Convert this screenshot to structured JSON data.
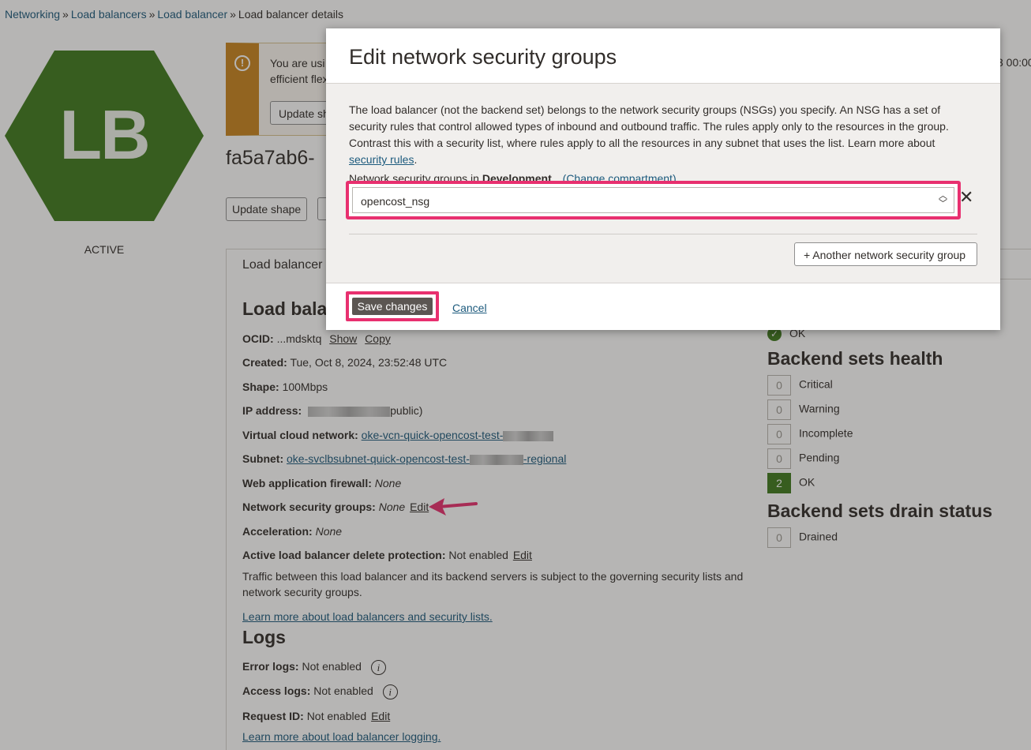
{
  "breadcrumb": {
    "items": [
      "Networking",
      "Load balancers",
      "Load balancer"
    ],
    "current": "Load balancer details",
    "separator": "»"
  },
  "badge": {
    "text": "LB",
    "state": "ACTIVE",
    "color": "#3f7a1e"
  },
  "notice": {
    "line1": "You are usi",
    "line2": "efficient flex",
    "button": "Update sh",
    "right_snippet": "3 00:00"
  },
  "lb_name": "fa5a7ab6-",
  "actions": {
    "update_shape": "Update shape"
  },
  "tab_label": "Load balancer",
  "info": {
    "heading": "Load bala",
    "ocid_label": "OCID:",
    "ocid_value": "...mdsktq",
    "show": "Show",
    "copy": "Copy",
    "created_label": "Created:",
    "created_value": "Tue, Oct 8, 2024, 23:52:48 UTC",
    "shape_label": "Shape:",
    "shape_value": "100Mbps",
    "ip_label": "IP address:",
    "ip_suffix": "public)",
    "vcn_label": "Virtual cloud network:",
    "vcn_value": "oke-vcn-quick-opencost-test-",
    "subnet_label": "Subnet:",
    "subnet_value": "oke-svclbsubnet-quick-opencost-test-",
    "subnet_suffix": "-regional",
    "waf_label": "Web application firewall:",
    "waf_value": "None",
    "nsg_label": "Network security groups:",
    "nsg_value": "None",
    "nsg_edit": "Edit",
    "accel_label": "Acceleration:",
    "accel_value": "None",
    "delete_label": "Active load balancer delete protection:",
    "delete_value": "Not enabled",
    "delete_edit": "Edit",
    "traffic_text": "Traffic between this load balancer and its backend servers is subject to the governing security lists and network security groups.",
    "learn_more": "Learn more about load balancers and security lists."
  },
  "logs": {
    "heading": "Logs",
    "error_label": "Error logs:",
    "error_value": "Not enabled",
    "access_label": "Access logs:",
    "access_value": "Not enabled",
    "request_label": "Request ID:",
    "request_value": "Not enabled",
    "request_edit": "Edit",
    "learn_more": "Learn more about load balancer logging."
  },
  "health": {
    "overall": "OK",
    "backend_heading": "Backend sets health",
    "rows": [
      {
        "count": "0",
        "label": "Critical"
      },
      {
        "count": "0",
        "label": "Warning"
      },
      {
        "count": "0",
        "label": "Incomplete"
      },
      {
        "count": "0",
        "label": "Pending"
      },
      {
        "count": "2",
        "label": "OK"
      }
    ],
    "drain_heading": "Backend sets drain status",
    "drain": {
      "count": "0",
      "label": "Drained"
    }
  },
  "modal": {
    "title": "Edit network security groups",
    "description": "The load balancer (not the backend set) belongs to the network security groups (NSGs) you specify. An NSG has a set of security rules that control allowed types of inbound and outbound traffic. The rules apply only to the resources in the group. Contrast this with a security list, where rules apply to all the resources in any subnet that uses the list. Learn more about",
    "description_link": "security rules",
    "description_end": ".",
    "nsg_in_label": "Network security groups in",
    "compartment": "Development",
    "change_compartment": "(Change compartment)",
    "selected_nsg": "opencost_nsg",
    "add_another": "+ Another network security group",
    "save": "Save changes",
    "cancel": "Cancel"
  },
  "colors": {
    "highlight": "#e8306f",
    "brand_green": "#3f7a1e",
    "link": "#1c5a7d"
  }
}
